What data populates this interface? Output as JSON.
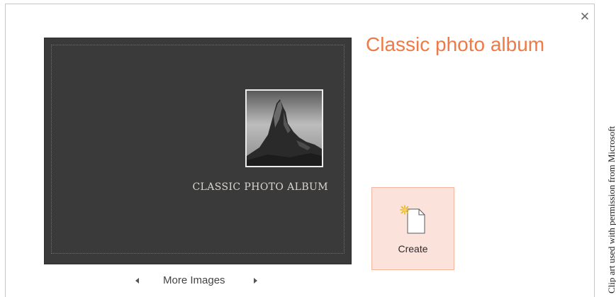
{
  "dialog": {
    "close_icon": "close-icon",
    "close_glyph": "✕"
  },
  "preview": {
    "album_title": "CLASSIC PHOTO ALBUM",
    "photo": "rock-formation-photo"
  },
  "navigation": {
    "prev_icon": "left-triangle-icon",
    "label": "More Images",
    "next_icon": "right-triangle-icon"
  },
  "template": {
    "name": "Classic photo album"
  },
  "create": {
    "label": "Create",
    "icon": "new-document-icon"
  },
  "credit": {
    "text": "Clip art used with permission from Microsoft"
  },
  "colors": {
    "title_accent": "#ee7a48",
    "create_bg": "#fbe3dc",
    "create_border": "#f3b4a0",
    "preview_bg": "#3b3a3a"
  }
}
